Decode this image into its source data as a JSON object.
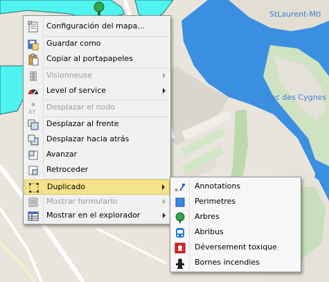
{
  "map": {
    "labels": {
      "st_laurent": "StLaurent-Mtl",
      "lac_des_cygnes": "Lac des Cygnes"
    },
    "colors": {
      "land": "#e8e4dc",
      "water": "#3b8fe0",
      "park": "#bddab0",
      "selection": "#4ff4f0",
      "road": "#ffffff"
    }
  },
  "context_menu": {
    "items": [
      {
        "label": "Configuración del mapa...",
        "icon": "map-config-icon",
        "enabled": true,
        "submenu": false
      },
      {
        "label": "Guardar como",
        "icon": "save-as-icon",
        "enabled": true,
        "submenu": false
      },
      {
        "label": "Copiar al portapapeles",
        "icon": "copy-clipboard-icon",
        "enabled": true,
        "submenu": false
      },
      {
        "label": "Visionneuse",
        "icon": "film-viewer-icon",
        "enabled": false,
        "submenu": true
      },
      {
        "label": "Level of service",
        "icon": "gauge-icon",
        "enabled": true,
        "submenu": true
      },
      {
        "label": "Desplazar el nodo",
        "icon": "move-node-xy-icon",
        "enabled": false,
        "submenu": false
      },
      {
        "label": "Desplazar al frente",
        "icon": "bring-to-front-icon",
        "enabled": true,
        "submenu": false
      },
      {
        "label": "Desplazar hacia atrás",
        "icon": "send-to-back-icon",
        "enabled": true,
        "submenu": false
      },
      {
        "label": "Avanzar",
        "icon": "bring-forward-icon",
        "enabled": true,
        "submenu": false
      },
      {
        "label": "Retroceder",
        "icon": "send-backward-icon",
        "enabled": true,
        "submenu": false
      },
      {
        "label": "Duplicado",
        "icon": "duplicate-selection-icon",
        "enabled": true,
        "submenu": true,
        "highlighted": true
      },
      {
        "label": "Mostrar formulario",
        "icon": "form-icon",
        "enabled": false,
        "submenu": true
      },
      {
        "label": "Mostrar en el explorador",
        "icon": "explorer-table-icon",
        "enabled": true,
        "submenu": true
      }
    ]
  },
  "duplicate_submenu": {
    "items": [
      {
        "label": "Annotations",
        "icon": "annotations-icon"
      },
      {
        "label": "Perimetres",
        "icon": "blue-square-icon"
      },
      {
        "label": "Arbres",
        "icon": "tree-icon"
      },
      {
        "label": "Abribus",
        "icon": "bus-shelter-icon"
      },
      {
        "label": "Déversement toxique",
        "icon": "toxic-spill-icon"
      },
      {
        "label": "Bornes incendies",
        "icon": "fire-hydrant-icon"
      }
    ]
  }
}
